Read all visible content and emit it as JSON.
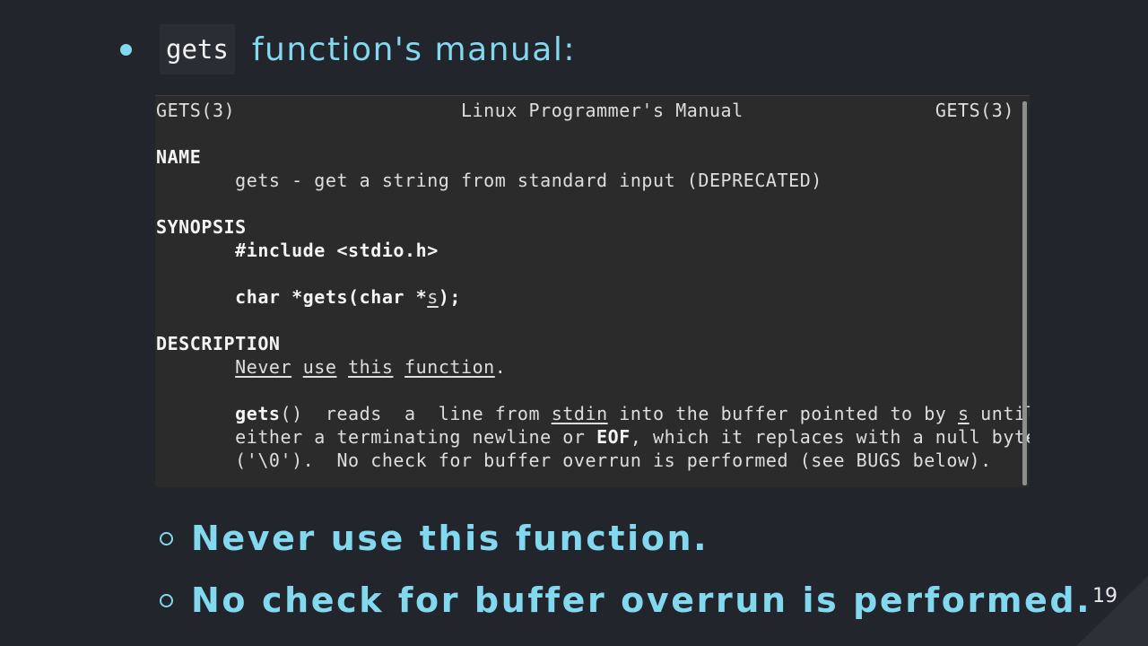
{
  "slide": {
    "code_term": "gets",
    "title_rest": "function's manual:",
    "page_number": "19"
  },
  "manual": {
    "header_left": "GETS(3)",
    "header_center": "Linux Programmer's Manual",
    "header_right": "GETS(3)",
    "name_heading": "NAME",
    "name_line": "gets - get a string from standard input (DEPRECATED)",
    "synopsis_heading": "SYNOPSIS",
    "synopsis_include": "#include <stdio.h>",
    "proto_start": "char *gets(char *",
    "proto_param": "s",
    "proto_end": ");",
    "description_heading": "DESCRIPTION",
    "desc_never": "Never",
    "desc_use": "use",
    "desc_this": "this",
    "desc_function": "function",
    "desc_period": ".",
    "p1_fn": "gets",
    "p1_a": "()  reads  a  line from ",
    "p1_stdin": "stdin",
    "p1_b": " into the buffer pointed to by ",
    "p1_s": "s",
    "p1_c": " until",
    "p2_a": "either a terminating newline or ",
    "p2_eof": "EOF",
    "p2_b": ", which it replaces with a null byte",
    "p3": "('\\0').  No check for buffer overrun is performed (see BUGS below)."
  },
  "points": [
    "Never use this function.",
    "No check for buffer overrun is performed."
  ],
  "colors": {
    "background": "#22252b",
    "accent": "#82d8ee",
    "terminal_bg": "#2b2b2b"
  }
}
